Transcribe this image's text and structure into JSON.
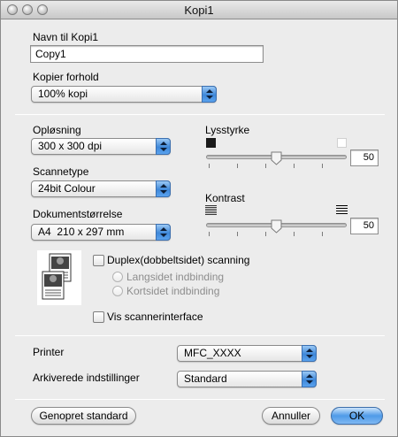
{
  "window": {
    "title": "Kopi1"
  },
  "copy_name": {
    "label": "Navn til Kopi1",
    "value": "Copy1"
  },
  "copy_ratio": {
    "label": "Kopier forhold",
    "value": "100% kopi"
  },
  "resolution": {
    "label": "Opløsning",
    "value": "300 x 300 dpi"
  },
  "scan_type": {
    "label": "Scannetype",
    "value": "24bit Colour"
  },
  "document_size": {
    "label": "Dokumentstørrelse",
    "value": "A4  210 x 297 mm"
  },
  "brightness": {
    "label": "Lysstyrke",
    "value": "50",
    "level": 0.5
  },
  "contrast": {
    "label": "Kontrast",
    "value": "50",
    "level": 0.5
  },
  "duplex": {
    "label": "Duplex(dobbeltsidet) scanning",
    "checked": false,
    "options": [
      "Langsidet indbinding",
      "Kortsidet indbinding"
    ]
  },
  "show_scanner_interface": {
    "label": "Vis scannerinterface",
    "checked": false
  },
  "printer": {
    "label": "Printer",
    "value": "MFC_XXXX"
  },
  "saved_settings": {
    "label": "Arkiverede indstillinger",
    "value": "Standard"
  },
  "buttons": {
    "restore": "Genopret standard",
    "cancel": "Annuller",
    "ok": "OK"
  },
  "icons": {
    "brightness_low": "black-square-icon",
    "brightness_high": "white-square-icon",
    "contrast_low": "low-contrast-icon",
    "contrast_high": "high-contrast-icon",
    "duplex_preview": "duplex-document-icon"
  }
}
